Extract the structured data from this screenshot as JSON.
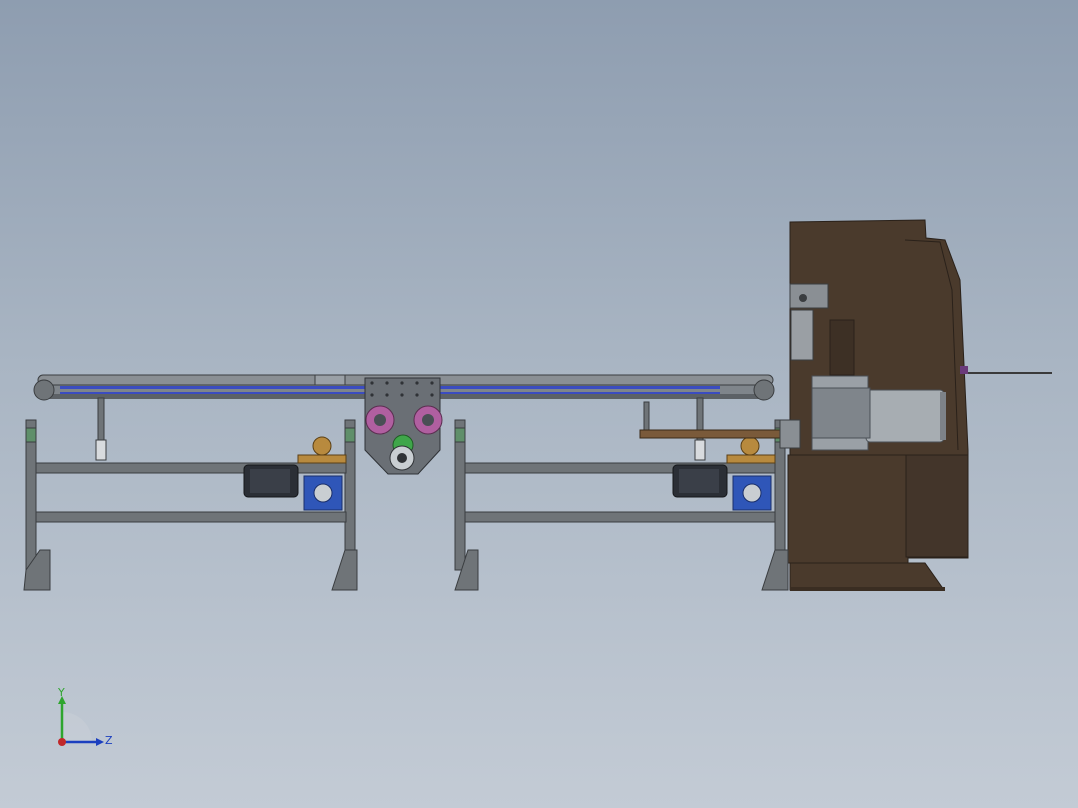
{
  "viewport": {
    "background_top": "#8e9db0",
    "background_bottom": "#c3cbd5"
  },
  "model": {
    "frame_color": "#6f7478",
    "belt_color": "#3b4cc0",
    "roller_color": "#8a8f94",
    "press_color": "#4a3a2c",
    "motor_color": "#2b2f36",
    "gearbox_color": "#2f56b8",
    "bracket_color": "#6a6f75",
    "wheel_color": "#b05fa0",
    "bearing_color": "#b88a3e",
    "post_accent": "#5f8f6a"
  },
  "triad": {
    "y_label": "Y",
    "z_label": "Z",
    "y_color": "#2ea52e",
    "z_color": "#1b3fbf",
    "origin_color": "#c0282a"
  }
}
